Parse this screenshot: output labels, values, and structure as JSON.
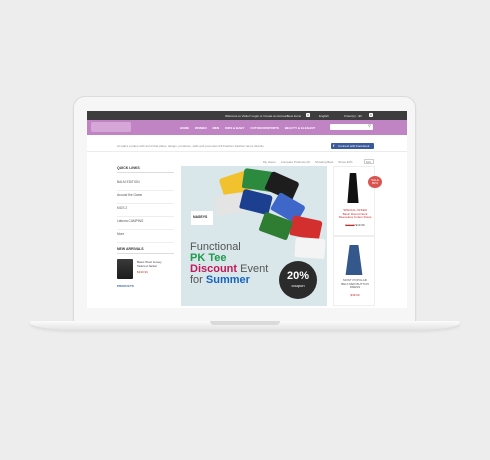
{
  "topbar": {
    "welcome": "Welcome to Visitor! Login or Create an Account",
    "new_items": "New items",
    "new_count": "0",
    "language": "English",
    "cart": "0 item(s) - $0",
    "cart_count": "0"
  },
  "nav": {
    "menu": [
      "HOME",
      "WOMEN",
      "MEN",
      "KIDS & BABY",
      "OUTDOOR/SPORTS",
      "BEAUTY & ELEGANT"
    ],
    "search_placeholder": ""
  },
  "intro": {
    "text": "At wak's a place with trend that place, design, produces, sells and promotes full Fashion Fashion items directly.",
    "facebook_label": "Connect with Facebook"
  },
  "breadcrumb": {
    "items": [
      "My Home",
      "Compare Products (0)",
      "Showing Bets",
      "Show 40%"
    ],
    "select": "$10"
  },
  "sidebar": {
    "quick_links_title": "QUICK LINKS",
    "links": [
      "BALM EDITION",
      "Around the Game",
      "KIDS 2",
      "Lafuma CAMPING",
      "More"
    ],
    "new_arrivals_title": "NEW ARRIVALS",
    "arrival_name": "Basic Wool Jersey Tailored Jacket",
    "arrival_price": "$199.99",
    "products_title": "PRODUCTS"
  },
  "banner": {
    "brand": "NASEYS",
    "line1": "Functional",
    "line2": "PK Tee",
    "line3a": "Discount",
    "line3b": "Event",
    "line4a": "for",
    "line4b": "Summer",
    "coupon_value": "20%",
    "coupon_label": "coupon"
  },
  "products": [
    {
      "badge": "SALE 80%",
      "name": "SPECIAL OFFER",
      "desc": "Basic Round Neck Sleeveless Cotton Dress",
      "price_old": "$29.00",
      "price": "$19.99"
    },
    {
      "name": "MOST POPULAR",
      "desc": "BELT-RED BUTTON DRESS",
      "price": "$39.00"
    }
  ],
  "colors": {
    "nav": "#c083c4",
    "topbar": "#3d3d3d",
    "facebook": "#3b5a9a",
    "banner_bg": "#d9e6ea"
  }
}
